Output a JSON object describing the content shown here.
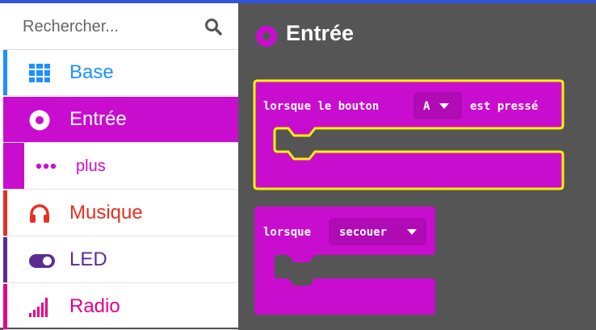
{
  "search": {
    "placeholder": "Rechercher..."
  },
  "categories": [
    {
      "label": "Base",
      "color": "#1e90ff",
      "icon": "grid-icon"
    },
    {
      "label": "Entrée",
      "color": "#c90dce",
      "icon": "radio-button-icon",
      "selected": true
    },
    {
      "label": "plus",
      "color": "#c90dce",
      "icon": "more-dots-icon",
      "sub": true
    },
    {
      "label": "Musique",
      "color": "#e63022",
      "icon": "headphones-icon"
    },
    {
      "label": "LED",
      "color": "#5c2d91",
      "icon": "toggle-icon"
    },
    {
      "label": "Radio",
      "color": "#e3008c",
      "icon": "signal-bars-icon"
    }
  ],
  "flyout": {
    "title": "Entrée",
    "icon": "radio-button-icon"
  },
  "blocks": [
    {
      "text_before": "lorsque le bouton",
      "dropdown_value": "A",
      "text_after": "est pressé",
      "color": "#c90dce",
      "highlight": "#fff200"
    },
    {
      "text_before": "lorsque",
      "dropdown_value": "secouer",
      "color": "#c90dce"
    }
  ]
}
